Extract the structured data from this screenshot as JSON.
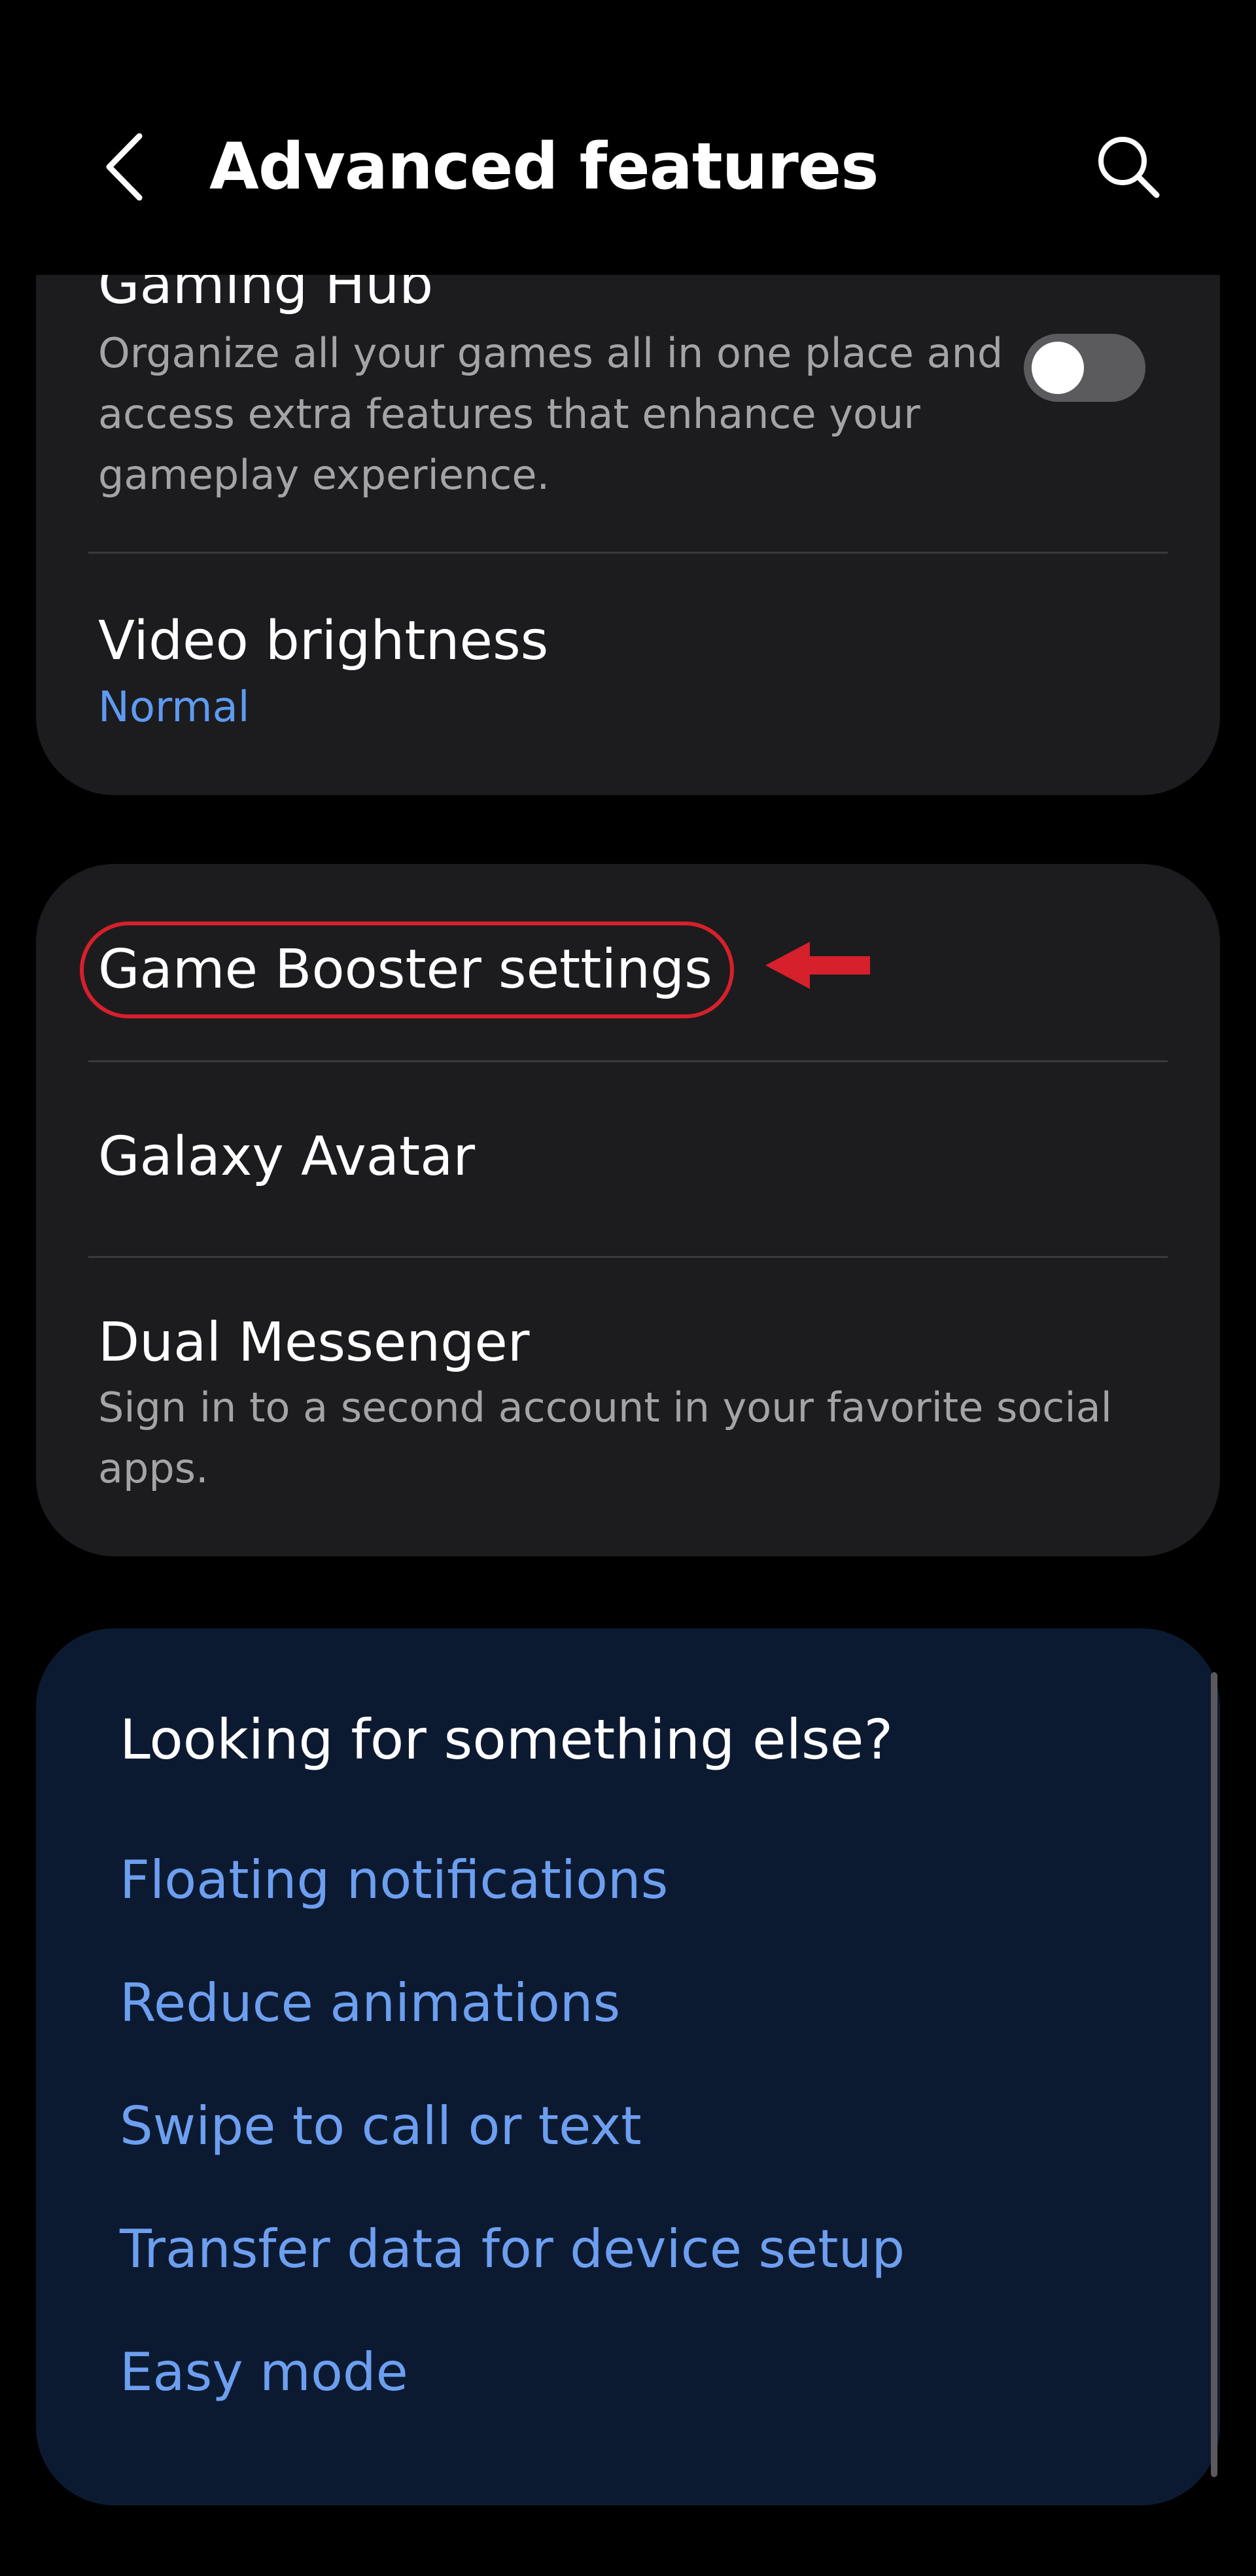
{
  "header": {
    "title": "Advanced features",
    "back_icon": "chevron-left-icon",
    "search_icon": "search-icon"
  },
  "card_1": {
    "gaming_hub": {
      "title": "Gaming Hub",
      "description": "Organize all your games all in one place and access extra features that enhance your gameplay experience.",
      "toggle_on": false
    },
    "video_brightness": {
      "title": "Video brightness",
      "value": "Normal"
    }
  },
  "card_2": {
    "game_booster": {
      "title": "Game Booster settings"
    },
    "galaxy_avatar": {
      "title": "Galaxy Avatar"
    },
    "dual_messenger": {
      "title": "Dual Messenger",
      "description": "Sign in to a second account in your favorite social apps."
    }
  },
  "suggestions": {
    "heading": "Looking for something else?",
    "links": [
      "Floating notifications",
      "Reduce animations",
      "Swipe to call or text",
      "Transfer data for device setup",
      "Easy mode"
    ]
  },
  "colors": {
    "background": "#000000",
    "card": "#1c1c1e",
    "suggest_card": "#0c1a31",
    "accent_link": "#6d9ff0",
    "value_text": "#5e9bf2",
    "annotation": "#d6202b"
  }
}
